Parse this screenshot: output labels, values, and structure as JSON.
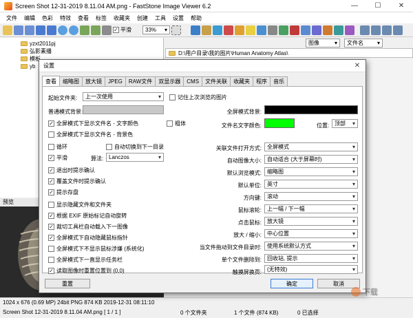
{
  "window": {
    "title": "Screen Shot 12-31-2019 8.11.04 AM.png  -  FastStone Image Viewer 6.2"
  },
  "menu": [
    "文件",
    "编辑",
    "色彩",
    "特效",
    "查看",
    "标签",
    "收藏夹",
    "创建",
    "工具",
    "设置",
    "帮助"
  ],
  "toolbar": {
    "zoom": "33%",
    "smooth_label": "平滑",
    "view_select": "图像",
    "sort_select": "文件名"
  },
  "tree": {
    "items": [
      "yzxt2011pj",
      "弘影素播",
      "模板",
      "yb"
    ]
  },
  "path": "D:\\用户目录\\我的图片\\Human Anatomy Atlas\\",
  "preview_label": "预览",
  "status": {
    "line1": "1024 x 676 (0.69 MP)   24bit  PNG   874 KB   2019-12-31 08:11:10",
    "line2": "Screen Shot 12-31-2019 8.11.04 AM.png  [ 1 / 1 ]",
    "dirs": "0 个文件夹",
    "files": "1 个文件 (874 KB)",
    "selected": "0 已选择"
  },
  "dialog": {
    "title": "设置",
    "tabs": [
      "查看",
      "缩略图",
      "放大镜",
      "JPEG",
      "RAW文件",
      "双显示器",
      "CMS",
      "文件关联",
      "收藏夹",
      "程序",
      "音乐"
    ],
    "left": {
      "startup_folder_label": "起始文件夹:",
      "startup_folder_value": "上一次使用",
      "remember_last": "记住上次浏览的图片",
      "normal_bg_label": "普通模式背景:",
      "check_show_name_color": "全屏模式下显示文件名 - 文字颜色",
      "bold": "粗体",
      "check_show_name_bg": "全屏模式下显示文件名 - 背景色",
      "loop": "循环",
      "auto_next": "自动切换到下一目录",
      "smooth": "平滑",
      "algo_label": "算法:",
      "algo_value": "Lanczos",
      "confirm_exit": "退出时提示确认",
      "confirm_overwrite": "覆盖文件时提示确认",
      "prompt_save": "提示存盘",
      "show_hidden": "显示隐藏文件和文件夹",
      "exif_rotate": "根据 EXIF 原始标记自动旋转",
      "crop_next": "裁切工具栏自动载入下一图像",
      "hide_cursor": "全屏模式下自动隐藏鼠标指针",
      "no_cursor_hint": "全屏模式下不显示鼠标涉嫌 (系统化)",
      "show_taskbar": "全屏模式下一直显示任务栏",
      "reset_pos": "读取图像时重置位置到 (0,0)"
    },
    "right": {
      "fullscreen_bg": "全屏模式背景:",
      "name_text_color": "文件名文字颜色:",
      "position_label": "位置:",
      "position_value": "顶部",
      "assoc_mode_label": "关联文件打开方式:",
      "assoc_mode_value": "全屏模式",
      "auto_size_label": "自动图像大小:",
      "auto_size_value": "自动适合 (大于屏幕时)",
      "default_view_label": "默认浏览模式:",
      "default_view_value": "缩略图",
      "units_label": "默认单位:",
      "units_value": "英寸",
      "arrow_label": "方向键:",
      "arrow_value": "滚动",
      "wheel_label": "鼠标滚轮:",
      "wheel_value": "上一幅 / 下一幅",
      "click_label": "点击鼠标:",
      "click_value": "放大镜",
      "zoom_label": "放大 / 缩小:",
      "zoom_value": "中心位置",
      "drag_label": "当文件拖动到文件目录时:",
      "drag_value": "使用系统默认方式",
      "delete_label": "单个文件删除到:",
      "delete_value": "回收站, 提示",
      "touch_label": "触摸屏换页:",
      "touch_value": "(无特效)"
    },
    "buttons": {
      "reset": "重置",
      "ok": "确定",
      "cancel": "取消"
    },
    "colors": {
      "fullscreen_bg": "#000000",
      "name_color": "#00ff00",
      "normal_bg": "#c8c8c8"
    }
  },
  "watermark": "下载"
}
